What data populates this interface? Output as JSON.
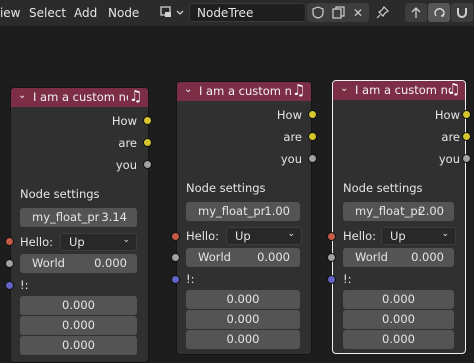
{
  "header": {
    "menu": [
      "View",
      "Select",
      "Add",
      "Node"
    ],
    "tree_name": "NodeTree",
    "tree_type_icon": "node-tree-icon"
  },
  "nodes": [
    {
      "title": "I am a custom no...",
      "outputs": [
        "How",
        "are",
        "you"
      ],
      "settings_label": "Node settings",
      "float_label": "my_float_pr",
      "float_value": "3.14",
      "hello_label": "Hello:",
      "hello_value": "Up",
      "world_label": "World",
      "world_value": "0.000",
      "bang_label": "!:",
      "vector": [
        "0.000",
        "0.000",
        "0.000"
      ]
    },
    {
      "title": "I am a custom no...",
      "outputs": [
        "How",
        "are",
        "you"
      ],
      "settings_label": "Node settings",
      "float_label": "my_float_pr",
      "float_value": "1.00",
      "hello_label": "Hello:",
      "hello_value": "Up",
      "world_label": "World",
      "world_value": "0.000",
      "bang_label": "!:",
      "vector": [
        "0.000",
        "0.000",
        "0.000"
      ]
    },
    {
      "title": "I am a custom node",
      "outputs": [
        "How",
        "are",
        "you"
      ],
      "settings_label": "Node settings",
      "float_label": "my_float_pr",
      "float_value": "2.00",
      "hello_label": "Hello:",
      "hello_value": "Up",
      "world_label": "World",
      "world_value": "0.000",
      "bang_label": "!:",
      "vector": [
        "0.000",
        "0.000",
        "0.000"
      ]
    }
  ],
  "colors": {
    "header_bg": "#7d2e47",
    "socket_yellow": "#d4c62c",
    "socket_grey": "#a1a1a1",
    "socket_red": "#c55a45",
    "socket_blue": "#6363c7"
  }
}
